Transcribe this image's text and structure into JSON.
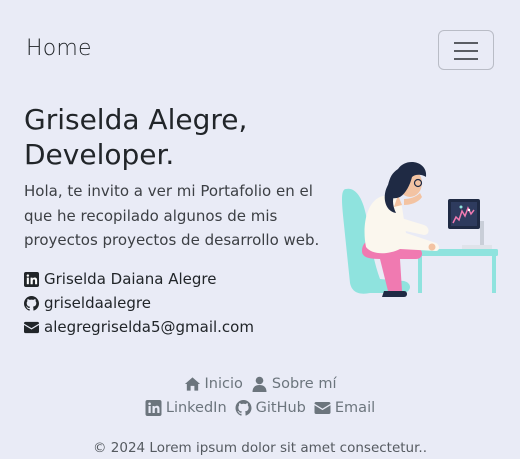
{
  "navbar": {
    "brand": "Home",
    "toggle_icon": "hamburger-icon"
  },
  "hero": {
    "title_line1": "Griselda Alegre,",
    "title_line2": "Developer.",
    "description": "Hola, te invito a ver mi Portafolio en el que he recopilado algunos de mis proyectos proyectos de desarrollo web.",
    "illustration_icon": "developer-at-desk-illustration"
  },
  "contacts": [
    {
      "icon": "linkedin-icon",
      "text": "Griselda Daiana Alegre"
    },
    {
      "icon": "github-icon",
      "text": "griseldaalegre"
    },
    {
      "icon": "envelope-icon",
      "text": "alegregriselda5@gmail.com"
    }
  ],
  "footer": {
    "nav": [
      {
        "icon": "home-icon",
        "label": "Inicio"
      },
      {
        "icon": "user-icon",
        "label": "Sobre mí"
      }
    ],
    "social": [
      {
        "icon": "linkedin-icon",
        "label": "LinkedIn"
      },
      {
        "icon": "github-icon",
        "label": "GitHub"
      },
      {
        "icon": "envelope-icon",
        "label": "Email"
      }
    ],
    "copyright": "© 2024 Lorem ipsum dolor sit amet consectetur.."
  },
  "colors": {
    "background": "#e9ebf6",
    "text": "#212529",
    "muted": "#6c757d",
    "illustration_teal": "#8fe3de",
    "illustration_pink": "#f07ab1"
  }
}
